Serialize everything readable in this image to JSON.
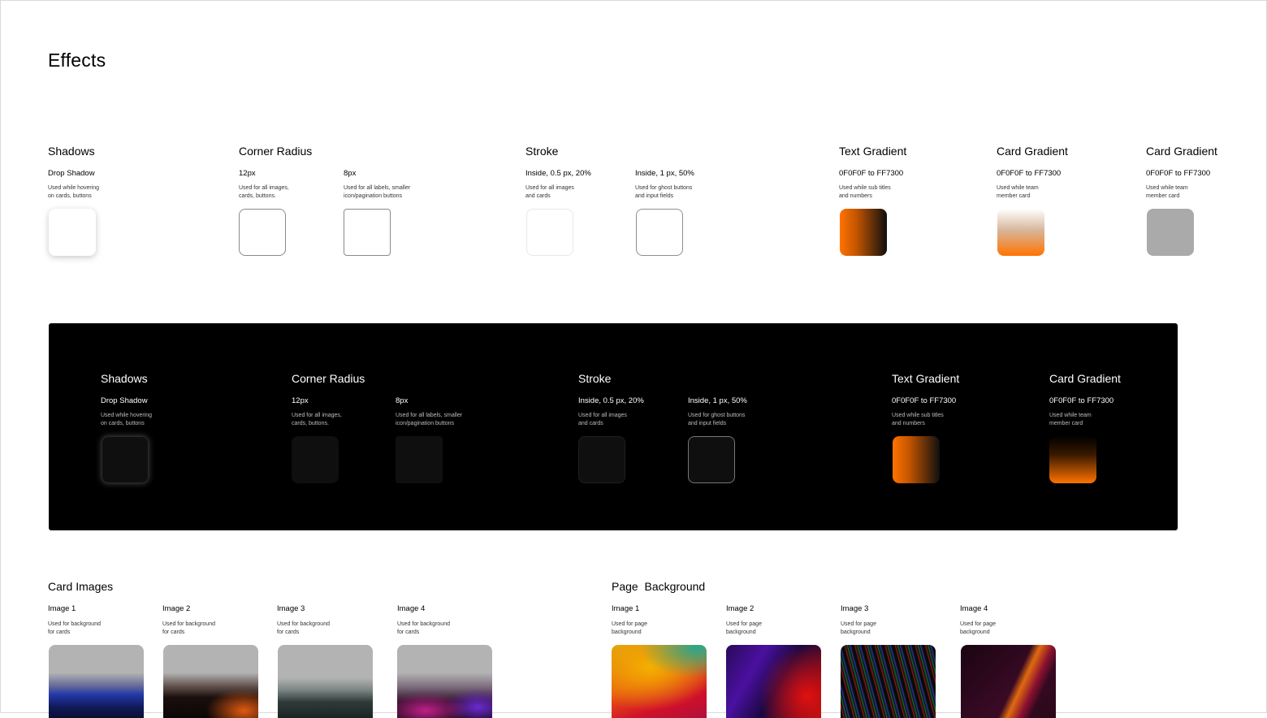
{
  "page": {
    "title": "Effects"
  },
  "light": {
    "shadows": {
      "heading": "Shadows",
      "sub": "Drop Shadow",
      "desc1": "Used while hovering",
      "desc2": "on cards, buttons"
    },
    "corner": {
      "heading": "Corner Radius",
      "r12": {
        "sub": "12px",
        "desc1": "Used for all images,",
        "desc2": "cards, buttons."
      },
      "r8": {
        "sub": "8px",
        "desc1": "Used for all labels, smaller",
        "desc2": "icon/pagination buttons"
      }
    },
    "stroke": {
      "heading": "Stroke",
      "s1": {
        "sub": "Inside, 0.5 px, 20%",
        "desc1": "Used for all images",
        "desc2": "and cards"
      },
      "s2": {
        "sub": "Inside, 1 px, 50%",
        "desc1": "Used for ghost buttons",
        "desc2": "and input fields"
      }
    },
    "text_gradient": {
      "heading": "Text Gradient",
      "sub": "0F0F0F to FF7300",
      "desc1": "Used while sub titles",
      "desc2": "and numbers"
    },
    "card_gradient1": {
      "heading": "Card Gradient",
      "sub": "0F0F0F to FF7300",
      "desc1": "Used while team",
      "desc2": "member card"
    },
    "card_gradient2": {
      "heading": "Card Gradient",
      "sub": "0F0F0F to FF7300",
      "desc1": "Used while team",
      "desc2": "member card"
    }
  },
  "dark": {
    "shadows": {
      "heading": "Shadows",
      "sub": "Drop Shadow",
      "desc1": "Used while hovering",
      "desc2": "on cards, buttons"
    },
    "corner": {
      "heading": "Corner Radius",
      "r12": {
        "sub": "12px",
        "desc1": "Used for all images,",
        "desc2": "cards, buttons."
      },
      "r8": {
        "sub": "8px",
        "desc1": "Used for all labels, smaller",
        "desc2": "icon/pagination buttons"
      }
    },
    "stroke": {
      "heading": "Stroke",
      "s1": {
        "sub": "Inside, 0.5 px, 20%",
        "desc1": "Used for all images",
        "desc2": "and cards"
      },
      "s2": {
        "sub": "Inside, 1 px, 50%",
        "desc1": "Used for ghost buttons",
        "desc2": "and input fields"
      }
    },
    "text_gradient": {
      "heading": "Text Gradient",
      "sub": "0F0F0F to FF7300",
      "desc1": "Used while sub titles",
      "desc2": "and numbers"
    },
    "card_gradient": {
      "heading": "Card Gradient",
      "sub": "0F0F0F to FF7300",
      "desc1": "Used while team",
      "desc2": "member card"
    }
  },
  "card_images": {
    "heading": "Card Images",
    "items": [
      {
        "label": "Image 1",
        "desc1": "Used for background",
        "desc2": "for cards"
      },
      {
        "label": "Image 2",
        "desc1": "Used for background",
        "desc2": "for cards"
      },
      {
        "label": "Image 3",
        "desc1": "Used for background",
        "desc2": "for cards"
      },
      {
        "label": "Image 4",
        "desc1": "Used for background",
        "desc2": "for cards"
      }
    ]
  },
  "page_background": {
    "heading": "Page  Background",
    "items": [
      {
        "label": "Image 1",
        "desc1": "Used for page",
        "desc2": "background"
      },
      {
        "label": "Image 2",
        "desc1": "Used for page",
        "desc2": "background"
      },
      {
        "label": "Image 3",
        "desc1": "Used for page",
        "desc2": "background"
      },
      {
        "label": "Image 4",
        "desc1": "Used for page",
        "desc2": "background"
      }
    ]
  },
  "colors": {
    "dark": "#0F0F0F",
    "accent": "#FF7300"
  }
}
